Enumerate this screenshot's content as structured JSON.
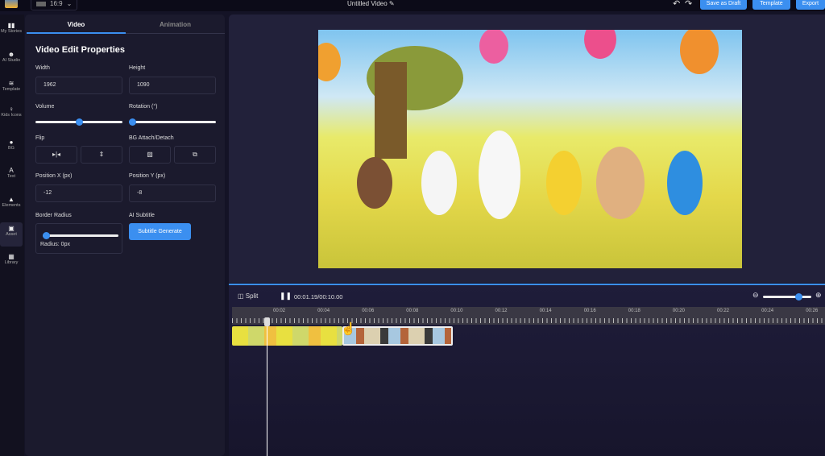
{
  "topbar": {
    "aspect_ratio": "16:9",
    "title": "Untitled Video",
    "save_draft": "Save as Draft",
    "template": "Template",
    "export": "Export"
  },
  "sidebar": {
    "items": [
      {
        "label": "My Stories",
        "icon": "book-icon"
      },
      {
        "label": "AI Studio",
        "icon": "robot-icon"
      },
      {
        "label": "Template",
        "icon": "layers-icon"
      },
      {
        "label": "Kids Icons",
        "icon": "kid-icon"
      },
      {
        "label": "BG",
        "icon": "palette-icon"
      },
      {
        "label": "Text",
        "icon": "text-icon"
      },
      {
        "label": "Elements",
        "icon": "shapes-icon"
      },
      {
        "label": "Asset",
        "icon": "asset-icon",
        "active": true
      },
      {
        "label": "Library",
        "icon": "library-icon"
      }
    ]
  },
  "panel": {
    "tabs": [
      "Video",
      "Animation"
    ],
    "active_tab": "Video",
    "heading": "Video Edit Properties",
    "width_label": "Width",
    "width": "1962",
    "height_label": "Height",
    "height": "1090",
    "volume_label": "Volume",
    "volume_percent": 50,
    "rotation_label": "Rotation (°)",
    "rotation": 0,
    "flip_label": "Flip",
    "bg_label": "BG Attach/Detach",
    "posx_label": "Position X (px)",
    "posx": "-12",
    "posy_label": "Position Y (px)",
    "posy": "-8",
    "radius_label": "Border Radius",
    "radius_text": "Radius: 0px",
    "radius": 0,
    "subtitle_label": "AI Subtitle",
    "subtitle_button": "Subtitle Generate"
  },
  "timeline": {
    "split": "Split",
    "time": "00:01.19/00:10.00",
    "zoom_percent": 85,
    "ticks": [
      "00:02",
      "00:04",
      "00:06",
      "00:08",
      "00:10",
      "00:12",
      "00:14",
      "00:16",
      "00:18",
      "00:20",
      "00:22",
      "00:24",
      "00:26"
    ]
  },
  "colors": {
    "accent": "#3b8ff0",
    "background": "#141326",
    "panel": "#1b1a2d"
  }
}
